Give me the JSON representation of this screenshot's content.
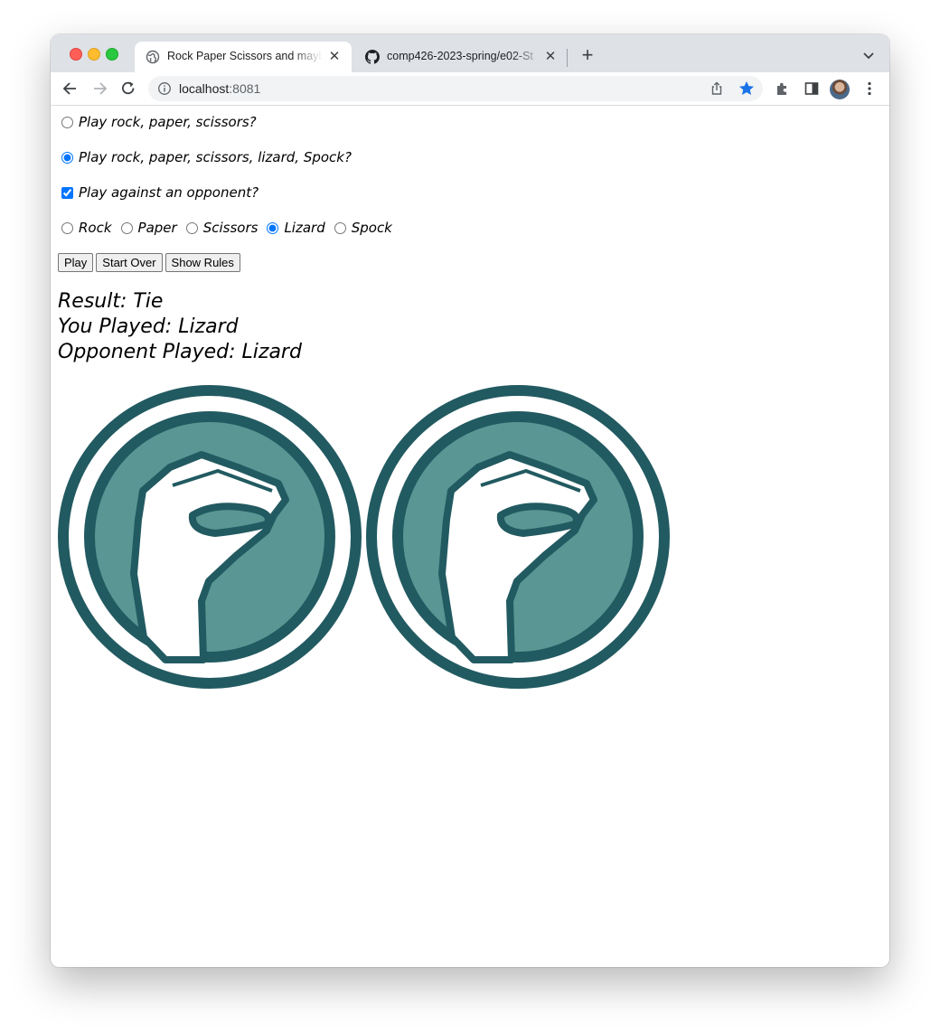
{
  "browser": {
    "tabs": [
      {
        "title": "Rock Paper Scissors and mayb",
        "active": true
      },
      {
        "title": "comp426-2023-spring/e02-St",
        "active": false
      }
    ],
    "url_host": "localhost",
    "url_port": ":8081",
    "star_color": "#1a73e8"
  },
  "options": {
    "game_rps": "Play rock, paper, scissors?",
    "game_rpsls": "Play rock, paper, scissors, lizard, Spock?",
    "opponent": "Play against an opponent?",
    "selected_game": "rpsls",
    "opponent_checked": true
  },
  "moves": {
    "items": [
      "Rock",
      "Paper",
      "Scissors",
      "Lizard",
      "Spock"
    ],
    "selected": "Lizard"
  },
  "buttons": {
    "play": "Play",
    "start_over": "Start Over",
    "show_rules": "Show Rules"
  },
  "result": {
    "line1": "Result: Tie",
    "line2": "You Played: Lizard",
    "line3": "Opponent Played: Lizard"
  },
  "images": {
    "player": "lizard",
    "opponent": "lizard",
    "ring_color": "#225a61",
    "fill_color": "#5a9694"
  }
}
